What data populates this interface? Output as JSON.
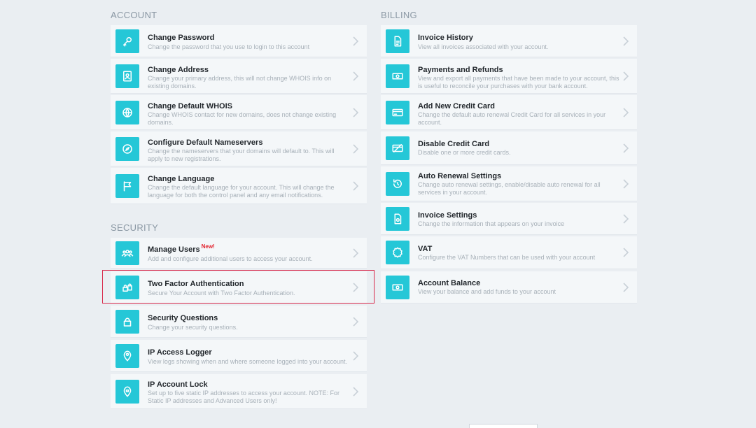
{
  "account": {
    "title": "ACCOUNT",
    "items": [
      {
        "title": "Change Password",
        "desc": "Change the password that you use to login to this account",
        "icon": "key-icon"
      },
      {
        "title": "Change Address",
        "desc": "Change your primary address, this will not change WHOIS info on existing domains.",
        "icon": "contact-card-icon"
      },
      {
        "title": "Change Default WHOIS",
        "desc": "Change WHOIS contact for new domains, does not change existing domains.",
        "icon": "globe-icon"
      },
      {
        "title": "Configure Default Nameservers",
        "desc": "Change the nameservers that your domains will default to. This will apply to new registrations.",
        "icon": "compass-icon"
      },
      {
        "title": "Change Language",
        "desc": "Change the default language for your account. This will change the language for both the control panel and any email notifications.",
        "icon": "flag-icon"
      }
    ]
  },
  "security": {
    "title": "SECURITY",
    "items": [
      {
        "title": "Manage Users",
        "badge": "New!",
        "desc": "Add and configure additional users to access your account.",
        "icon": "users-icon"
      },
      {
        "title": "Two Factor Authentication",
        "desc": "Secure Your Account with Two Factor Authentication.",
        "icon": "double-lock-icon"
      },
      {
        "title": "Security Questions",
        "desc": "Change your security questions.",
        "icon": "lock-icon"
      },
      {
        "title": "IP Access Logger",
        "desc": "View logs showing when and where someone logged into your account.",
        "icon": "map-pin-icon"
      },
      {
        "title": "IP Account Lock",
        "desc": "Set up to five static IP addresses to access your account. NOTE: For Static IP addresses and Advanced Users only!",
        "icon": "pin-lock-icon"
      }
    ]
  },
  "billing": {
    "title": "BILLING",
    "items": [
      {
        "title": "Invoice History",
        "desc": "View all invoices associated with your account.",
        "icon": "invoice-icon"
      },
      {
        "title": "Payments and Refunds",
        "desc": "View and export all payments that have been made to your account, this is useful to reconcile your purchases with your bank account.",
        "icon": "cash-icon"
      },
      {
        "title": "Add New Credit Card",
        "desc": "Change the default auto renewal Credit Card for all services in your account.",
        "icon": "credit-card-icon"
      },
      {
        "title": "Disable Credit Card",
        "desc": "Disable one or more credit cards.",
        "icon": "card-disabled-icon"
      },
      {
        "title": "Auto Renewal Settings",
        "desc": "Change auto renewal settings, enable/disable auto renewal for all services in your account.",
        "icon": "renew-icon"
      },
      {
        "title": "Invoice Settings",
        "desc": "Change the information that appears on your invoice",
        "icon": "invoice-gear-icon"
      },
      {
        "title": "VAT",
        "desc": "Configure the VAT Numbers that can be used with your account",
        "icon": "vat-badge-icon"
      },
      {
        "title": "Account Balance",
        "desc": "View your balance and add funds to your account",
        "icon": "wallet-icon"
      }
    ]
  }
}
